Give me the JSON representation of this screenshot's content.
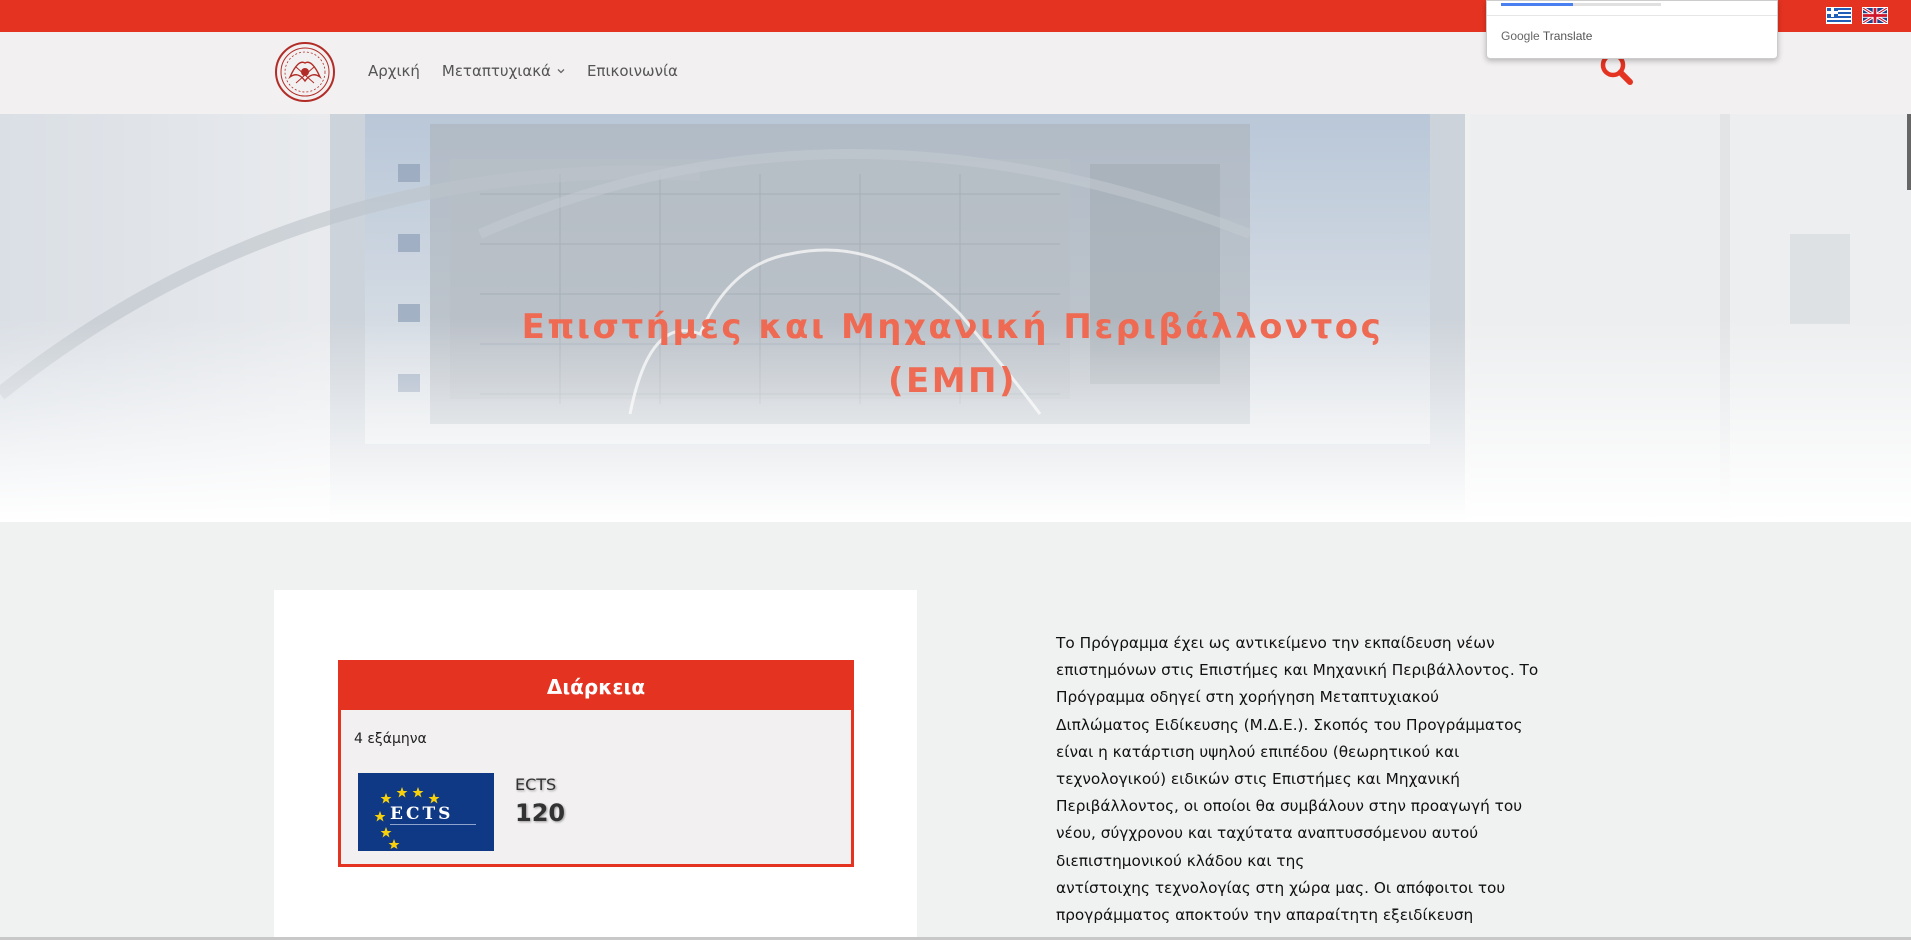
{
  "translate_popup": {
    "brand": "Google",
    "label": "Translate",
    "progress": 0.45
  },
  "languages": [
    {
      "name": "greek-flag-icon"
    },
    {
      "name": "uk-flag-icon"
    }
  ],
  "nav": {
    "items": [
      {
        "label": "Αρχική",
        "has_dropdown": false
      },
      {
        "label": "Μεταπτυχιακά",
        "has_dropdown": true
      },
      {
        "label": "Επικοινωνία",
        "has_dropdown": false
      }
    ],
    "search_icon": "search-icon"
  },
  "hero": {
    "title_line1": "Επιστήμες και Μηχανική Περιβάλλοντος",
    "title_line2": "(ΕΜΠ)"
  },
  "duration_card": {
    "heading": "Διάρκεια",
    "semesters": "4 εξάμηνα",
    "ects_logo_text": "ECTS",
    "ects_label": "ECTS",
    "ects_value": "120"
  },
  "description": {
    "lines": [
      "Το Πρόγραμμα έχει ως αντικείμενο την εκπαίδευση νέων",
      "επιστημόνων στις Επιστήμες και Μηχανική Περιβάλλοντος. Το",
      "Πρόγραμμα οδηγεί στη χορήγηση Μεταπτυχιακού",
      "Διπλώματος Ειδίκευσης (Μ.Δ.Ε.). Σκοπός του Προγράμματος",
      "είναι η κατάρτιση υψηλού επιπέδου (θεωρητικού και",
      "τεχνολογικού) ειδικών στις Επιστήμες και Μηχανική",
      "Περιβάλλοντος, οι οποίοι θα συμβάλουν στην προαγωγή του",
      "νέου, σύγχρονου και ταχύτατα αναπτυσσόμενου αυτού",
      "διεπιστημονικού κλάδου και της",
      "αντίστοιχης τεχνολογίας στη χώρα μας. Οι απόφοιτοι του",
      "προγράμματος αποκτούν την απαραίτητη εξειδίκευση"
    ]
  },
  "colors": {
    "brand_red": "#e53322",
    "title_salmon": "#ef6a52",
    "ects_blue": "#103985"
  }
}
